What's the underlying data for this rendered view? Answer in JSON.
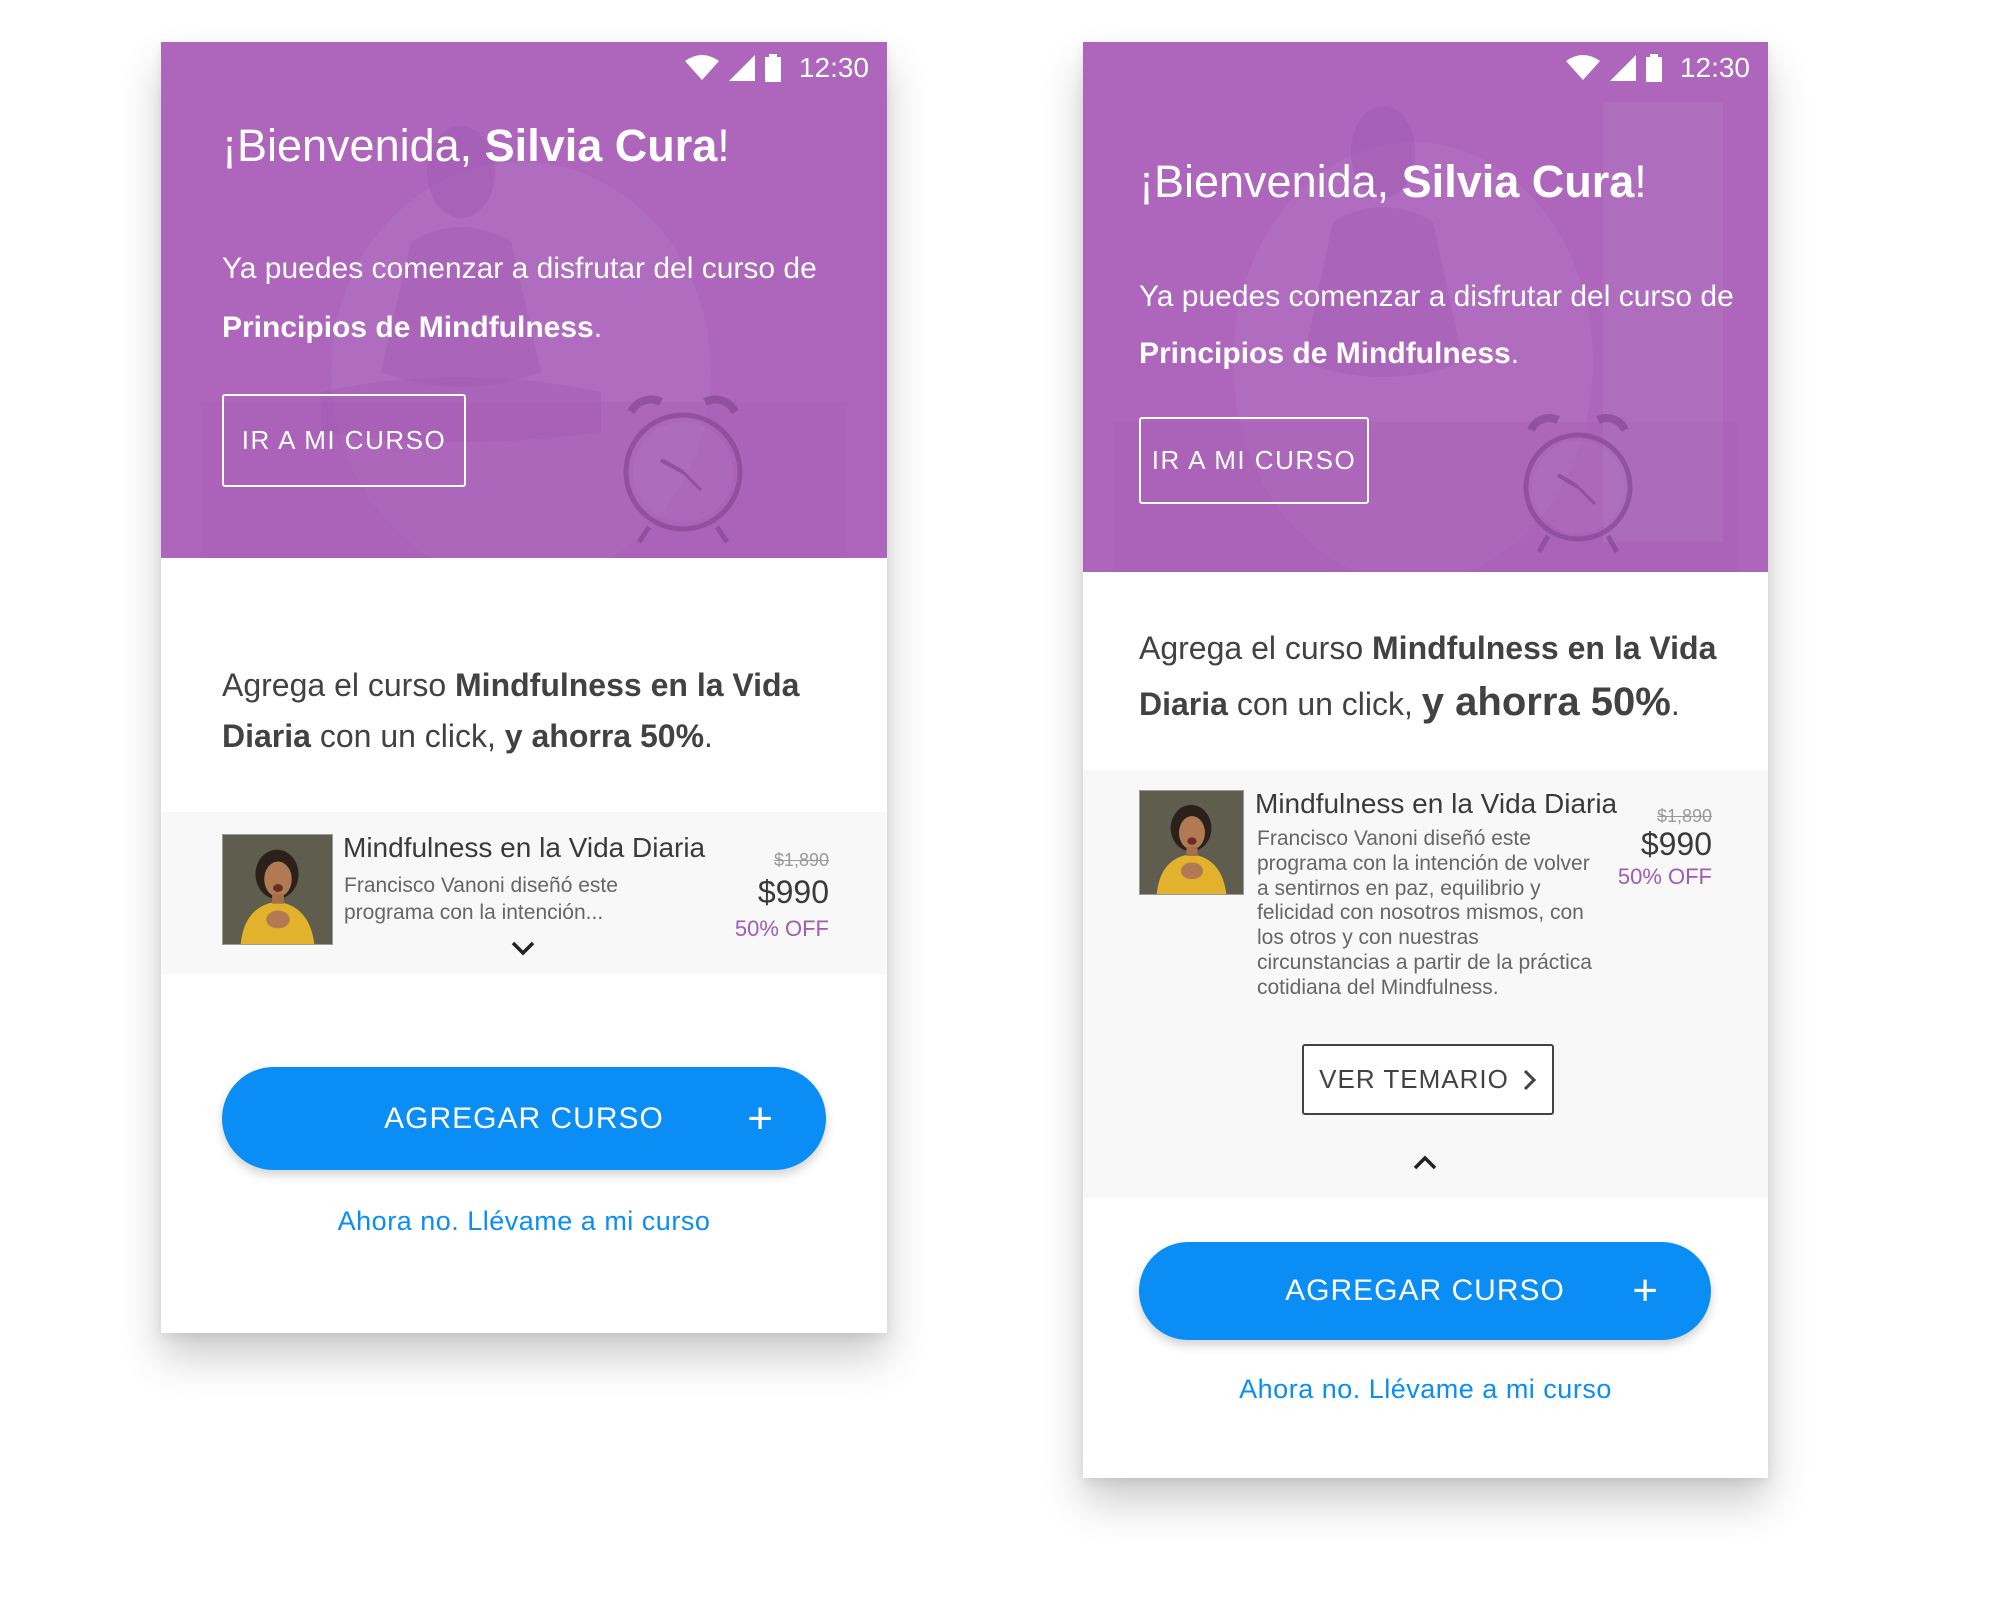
{
  "colors": {
    "hero_purple": "#ad66bc",
    "accent_blue": "#0a8ef5",
    "discount_purple": "#a25bb5",
    "page_background": "#ffffff"
  },
  "status_bar": {
    "time": "12:30",
    "icons": [
      "wifi-icon",
      "signal-icon",
      "battery-icon"
    ]
  },
  "screens": [
    {
      "state": "collapsed",
      "hero": {
        "greeting": "¡Bienvenida, ",
        "user_name": "Silvia Cura",
        "greeting_end": "!",
        "intro_text": "Ya puedes comenzar a disfrutar del curso de ",
        "course_name": "Principios de Mindfulness",
        "intro_end": ".",
        "button_label": "IR A MI CURSO"
      },
      "offer": {
        "prefix": "Agrega el curso ",
        "course_name": "Mindfulness en la Vida Diaria",
        "middle": " con un click, ",
        "highlight": "y ahorra 50%",
        "suffix": "."
      },
      "course": {
        "title": "Mindfulness en la Vida Diaria",
        "description": "Francisco Vanoni diseñó este programa con la intención...",
        "price_old": "$1,890",
        "price_new": "$990",
        "discount": "50% OFF",
        "toggle_icon": "chevron-down-icon"
      },
      "cta_label": "AGREGAR CURSO",
      "cta_icon": "plus-icon",
      "skip_link": "Ahora no. Llévame a mi curso"
    },
    {
      "state": "expanded",
      "hero": {
        "greeting": "¡Bienvenida, ",
        "user_name": "Silvia Cura",
        "greeting_end": "!",
        "intro_text": "Ya puedes comenzar a disfrutar del curso de ",
        "course_name": "Principios de Mindfulness",
        "intro_end": ".",
        "button_label": "IR A MI CURSO"
      },
      "offer": {
        "prefix": "Agrega el curso ",
        "course_name": "Mindfulness en la Vida Diaria",
        "middle": " con un click, ",
        "highlight": "y ahorra 50%",
        "suffix": "."
      },
      "course": {
        "title": "Mindfulness en la Vida Diaria",
        "description": "Francisco Vanoni diseñó este programa con la intención de volver a sentirnos en paz, equilibrio y felicidad con nosotros mismos, con los otros y con nuestras circunstancias a partir de la práctica cotidiana del Mindfulness.",
        "price_old": "$1,890",
        "price_new": "$990",
        "discount": "50% OFF",
        "syllabus_button": "VER TEMARIO",
        "toggle_icon": "chevron-up-icon"
      },
      "cta_label": "AGREGAR CURSO",
      "cta_icon": "plus-icon",
      "skip_link": "Ahora no. Llévame a mi curso"
    }
  ]
}
